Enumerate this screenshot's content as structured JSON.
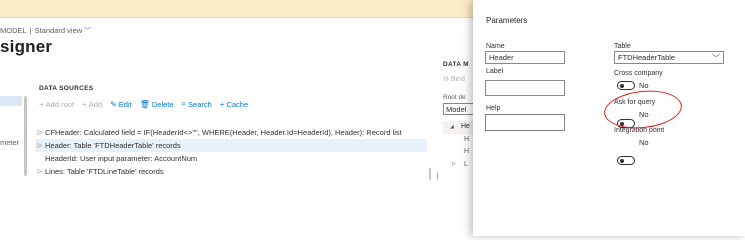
{
  "header": {
    "model_text": "MODEL",
    "separator": "|",
    "view_label": "Standard view",
    "view_chevron_icon": "chevron-down-icon",
    "title": "signer"
  },
  "left_panel": {
    "partial_label": "meter"
  },
  "data_sources": {
    "heading": "DATA SOURCES",
    "toolbar": [
      {
        "label": "Add root",
        "icon": "+",
        "enabled": false
      },
      {
        "label": "Add",
        "icon": "+",
        "enabled": false
      },
      {
        "label": "Edit",
        "icon": "✎",
        "enabled": true
      },
      {
        "label": "Delete",
        "icon": "🗑",
        "enabled": true
      },
      {
        "label": "Search",
        "icon": "⌕",
        "enabled": true
      },
      {
        "label": "Cache",
        "icon": "+",
        "enabled": true
      }
    ],
    "rows": [
      {
        "text": "CFHeader: Calculated field = IF(HeaderId<>\"\", WHERE(Header, Header.Id=HeaderId), Header): Record list",
        "expander": "▷",
        "selected": false
      },
      {
        "text": "Header: Table 'FTDHeaderTable' records",
        "expander": "▷",
        "selected": true
      },
      {
        "text": "HeaderId: User input parameter: AccountNum",
        "expander": "",
        "selected": false
      },
      {
        "text": "Lines: Table 'FTDLineTable' records",
        "expander": "▷",
        "selected": false
      }
    ]
  },
  "data_model": {
    "heading": "DATA M",
    "bind_label": "Bind",
    "root_label": "Root de",
    "model_value": "Model",
    "tree": [
      "◢",
      "He",
      "H",
      "H",
      "▷",
      "L"
    ]
  },
  "parameters": {
    "title": "Parameters",
    "name_label": "Name",
    "name_value": "Header",
    "label_label": "Label",
    "label_value": "",
    "help_label": "Help",
    "help_value": "",
    "table_label": "Table",
    "table_value": "FTDHeaderTable",
    "table_chevron_icon": "chevron-down-icon",
    "cross_company_label": "Cross company",
    "cross_company_value": "No",
    "ask_query_label": "Ask for query",
    "ask_query_value": "No",
    "integration_point_label": "Integration point",
    "integration_point_value": "No",
    "highlight_color": "#e2231a"
  },
  "colors": {
    "accent": "#0078d4",
    "banner": "#fcebc7",
    "selected_row": "#e8f1fa"
  }
}
